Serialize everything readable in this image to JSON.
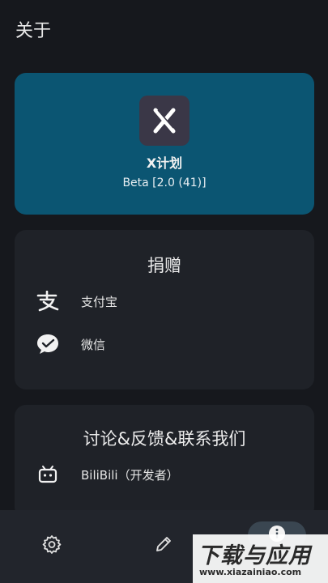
{
  "header": {
    "title": "关于"
  },
  "app": {
    "name": "X计划",
    "version": "Beta [2.0 (41)]",
    "logo_icon": "x-logo-icon"
  },
  "donate": {
    "title": "捐赠",
    "items": [
      {
        "label": "支付宝",
        "icon": "alipay-icon"
      },
      {
        "label": "微信",
        "icon": "wechat-icon"
      }
    ]
  },
  "contact": {
    "title": "讨论&反馈&联系我们",
    "items": [
      {
        "label": "BiliBili（开发者）",
        "icon": "bilibili-icon"
      }
    ]
  },
  "bottom_nav": {
    "items": [
      {
        "icon": "settings-icon"
      },
      {
        "icon": "edit-icon"
      },
      {
        "icon": "info-icon",
        "active": true
      }
    ]
  },
  "watermark": {
    "main": "下载与应用",
    "url": "www.xiazainiao.com"
  },
  "colors": {
    "background": "#16181d",
    "app_card": "#0b5572",
    "card": "#1f2228",
    "nav": "#22252c"
  }
}
